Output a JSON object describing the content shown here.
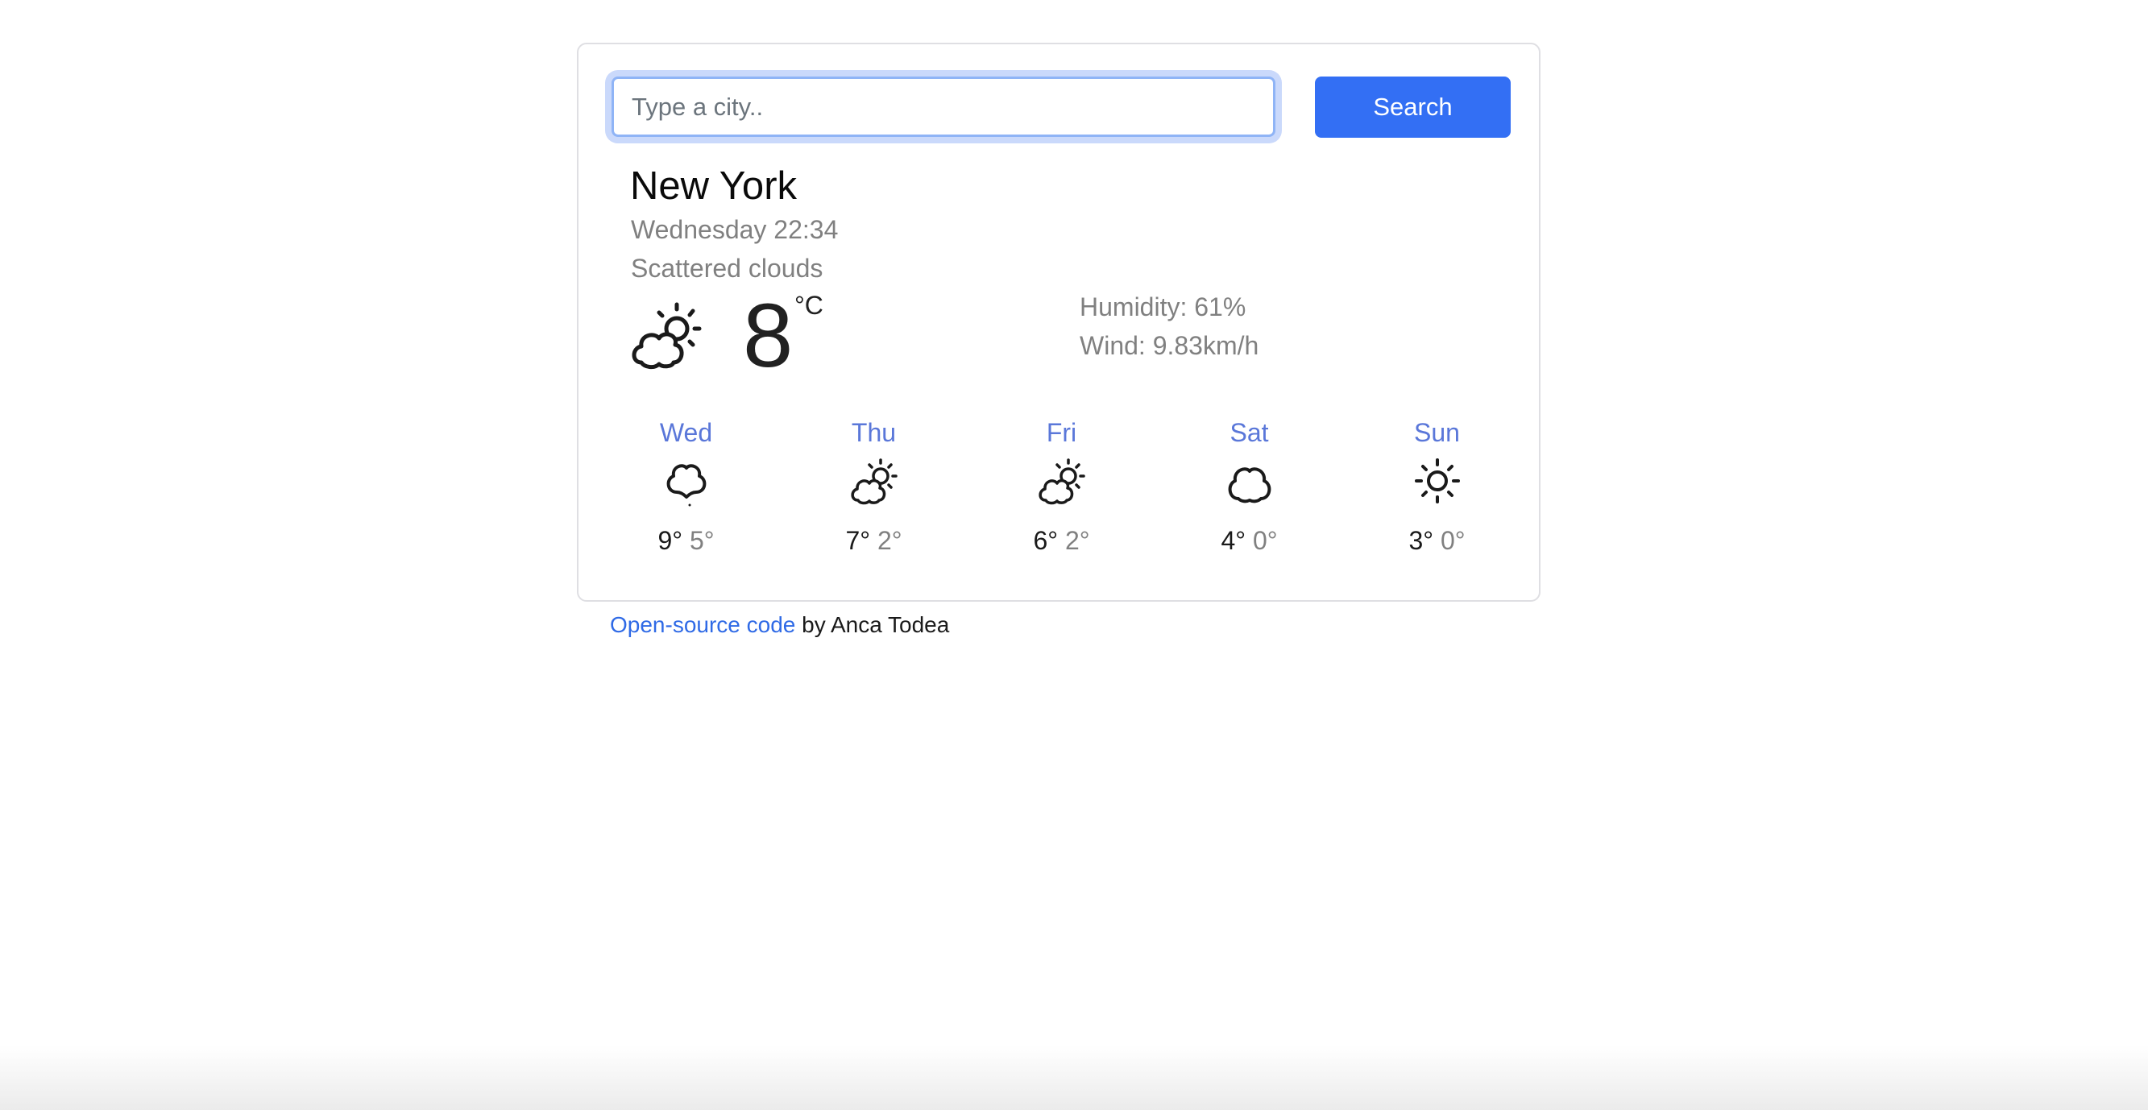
{
  "search": {
    "placeholder": "Type a city..",
    "value": "",
    "button_label": "Search"
  },
  "current": {
    "city": "New York",
    "datetime": "Wednesday 22:34",
    "description": "Scattered clouds",
    "icon": "partly-cloudy-icon",
    "temperature": "8",
    "unit": "°C",
    "humidity": "Humidity: 61%",
    "wind": "Wind: 9.83km/h"
  },
  "forecast": [
    {
      "day": "Wed",
      "icon": "rain-cloud-icon",
      "max": "9°",
      "min": "5°"
    },
    {
      "day": "Thu",
      "icon": "partly-cloudy-icon",
      "max": "7°",
      "min": "2°"
    },
    {
      "day": "Fri",
      "icon": "partly-cloudy-icon",
      "max": "6°",
      "min": "2°"
    },
    {
      "day": "Sat",
      "icon": "cloud-icon",
      "max": "4°",
      "min": "0°"
    },
    {
      "day": "Sun",
      "icon": "sun-icon",
      "max": "3°",
      "min": "0°"
    }
  ],
  "footer": {
    "link_text": "Open-source code",
    "suffix": " by Anca Todea"
  },
  "colors": {
    "accent": "#336ff4",
    "day_label": "#5a77d9",
    "muted_text": "#808080",
    "link": "#2f6ae6"
  }
}
